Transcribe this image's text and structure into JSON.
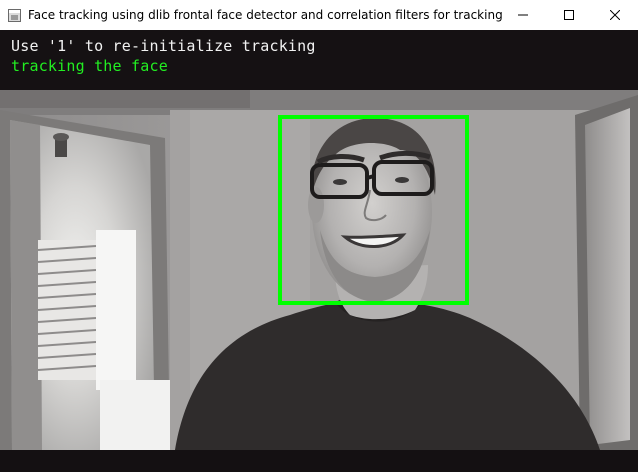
{
  "window": {
    "title": "Face tracking using dlib frontal face detector and correlation filters for tracking",
    "controls": {
      "minimize_icon": "minimize-icon",
      "maximize_icon": "maximize-icon",
      "close_icon": "close-icon"
    }
  },
  "overlay": {
    "instruction": "Use '1' to re-initialize tracking",
    "status": "tracking the face",
    "instruction_color": "#f2f2f2",
    "status_color": "#22ee22"
  },
  "camera": {
    "tracking_box_color": "#00ff00"
  }
}
